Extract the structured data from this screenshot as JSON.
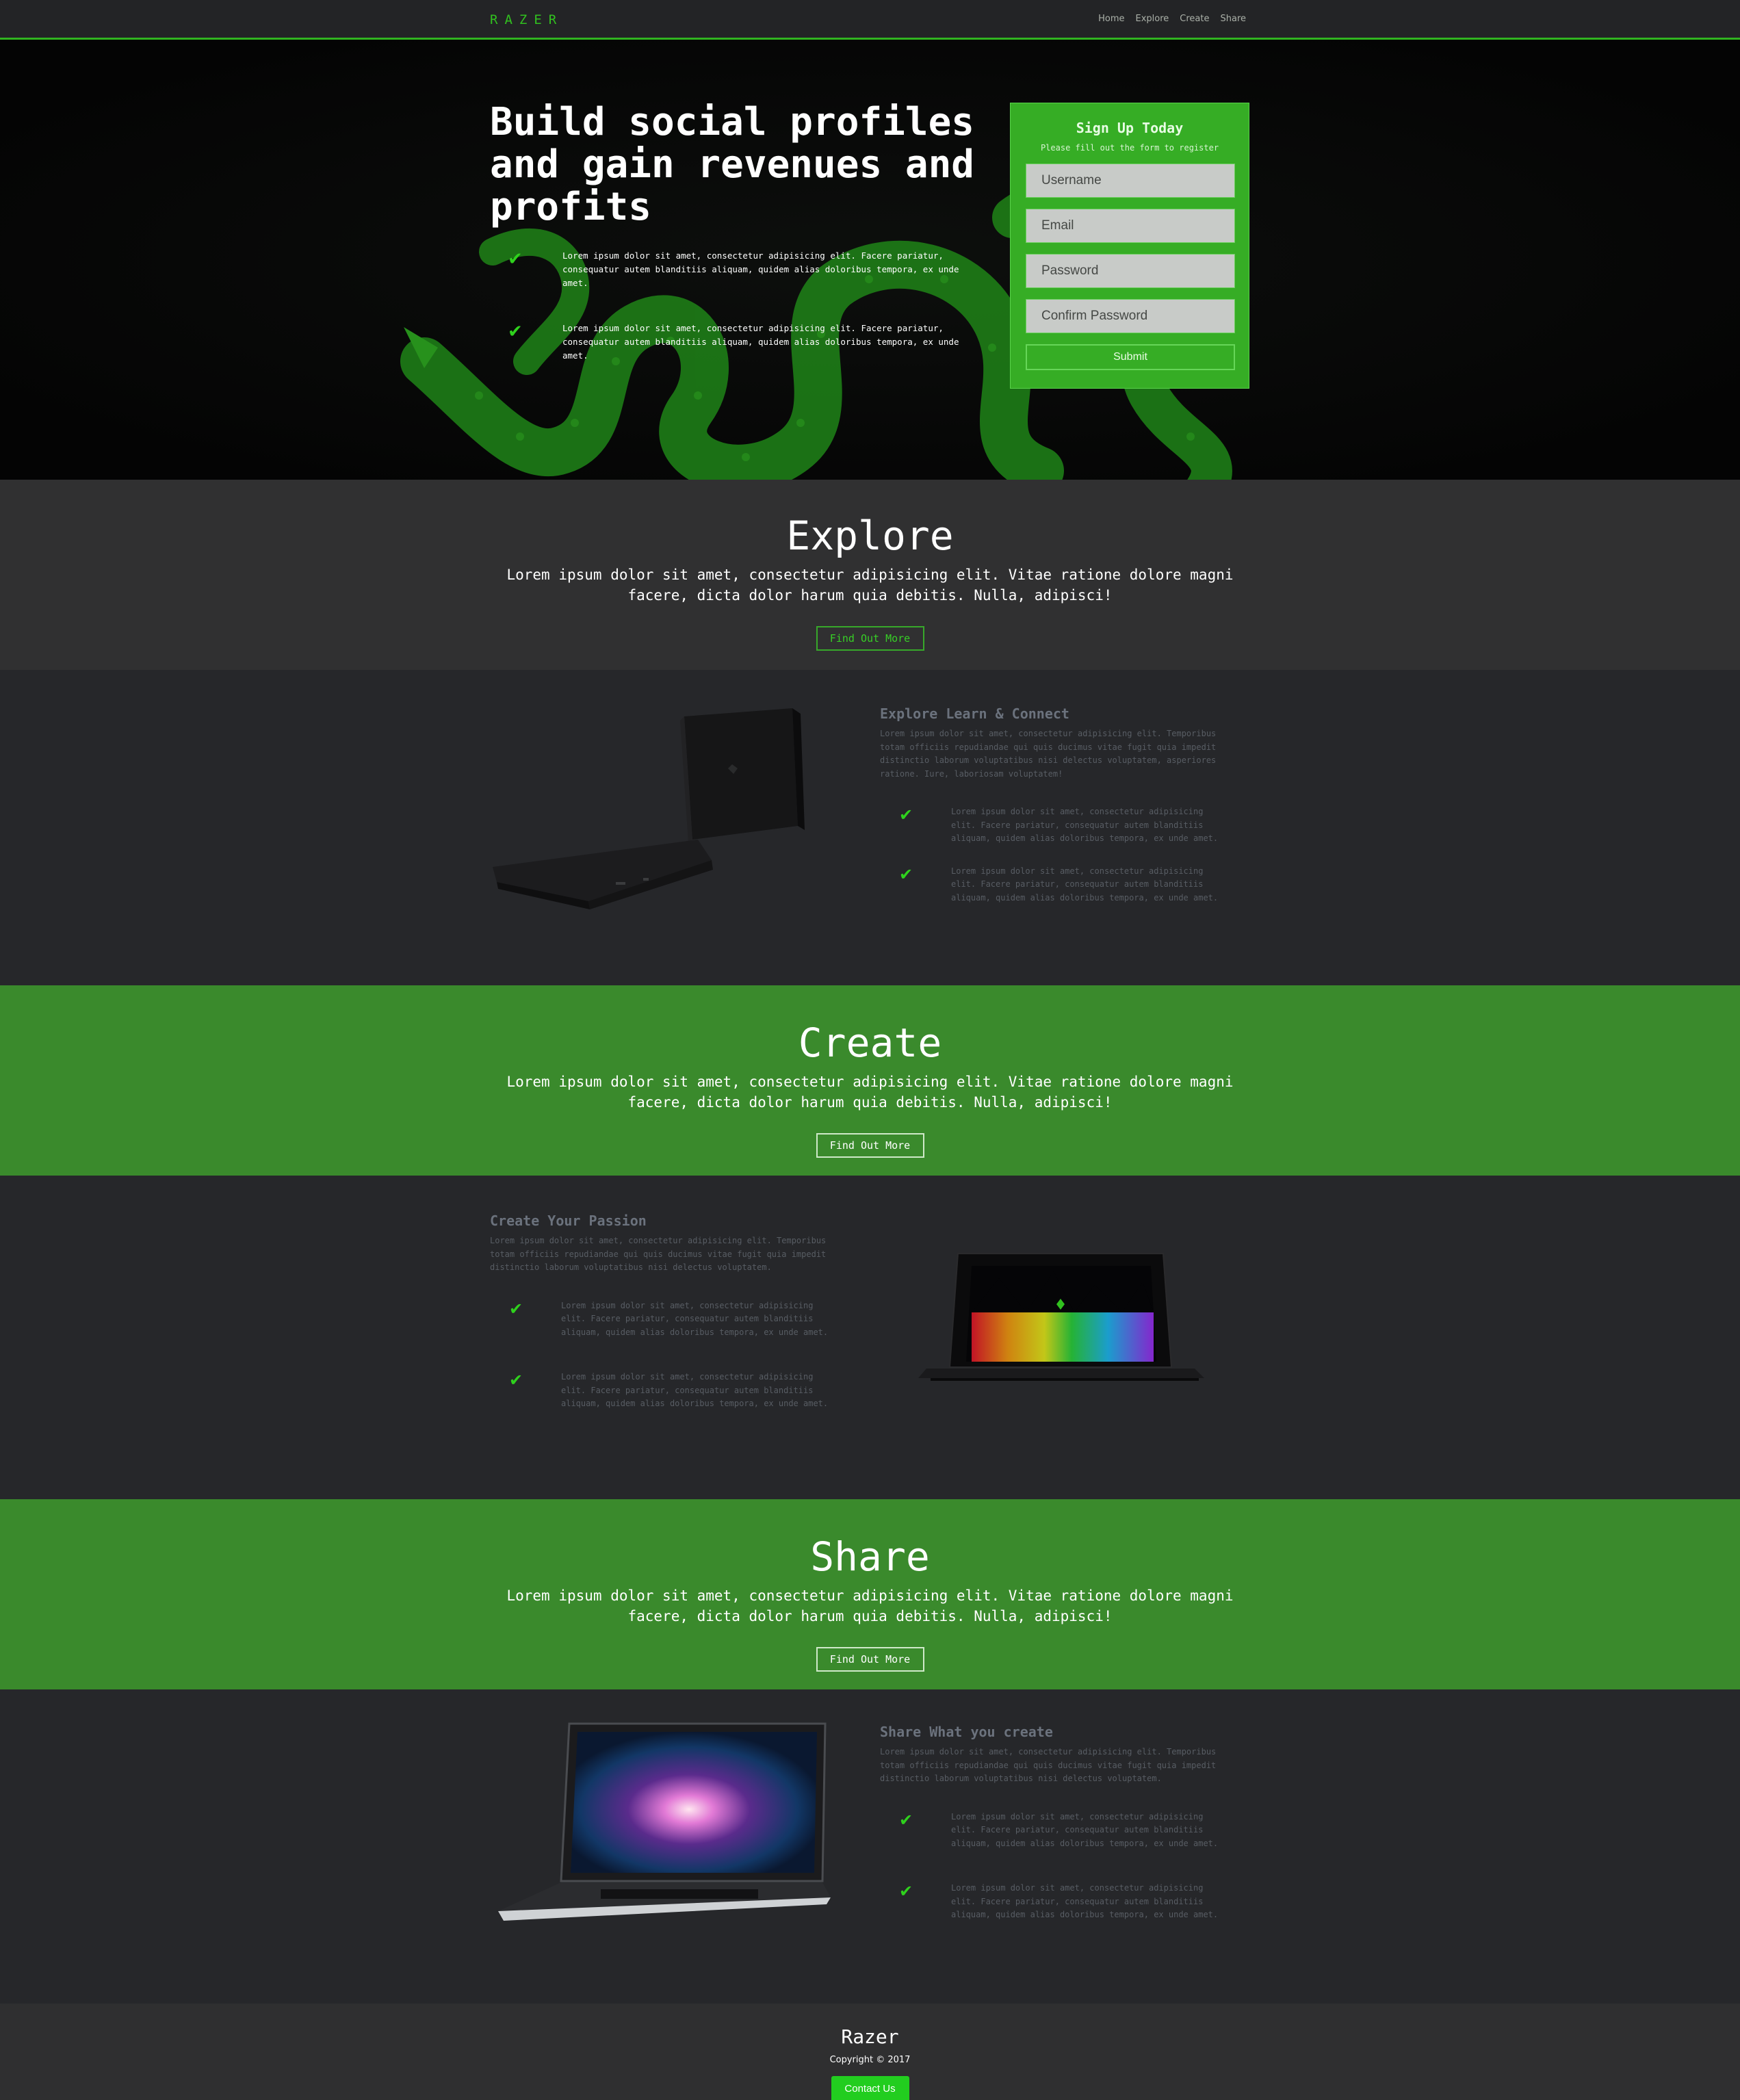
{
  "nav": {
    "brand": "RAZER",
    "links": [
      "Home",
      "Explore",
      "Create",
      "Share"
    ]
  },
  "hero": {
    "title": "Build social profiles and gain revenues and profits",
    "items": [
      "Lorem ipsum dolor sit amet, consectetur adipisicing elit. Facere pariatur, consequatur autem blanditiis aliquam, quidem alias doloribus tempora, ex unde amet.",
      "Lorem ipsum dolor sit amet, consectetur adipisicing elit. Facere pariatur, consequatur autem blanditiis aliquam, quidem alias doloribus tempora, ex unde amet."
    ]
  },
  "signup": {
    "title": "Sign Up Today",
    "subtitle": "Please fill out the form to register",
    "username_placeholder": "Username",
    "email_placeholder": "Email",
    "password_placeholder": "Password",
    "confirm_placeholder": "Confirm Password",
    "submit_label": "Submit"
  },
  "explore": {
    "title": "Explore",
    "text": "Lorem ipsum dolor sit amet, consectetur adipisicing elit. Vitae ratione dolore magni facere, dicta dolor harum quia debitis. Nulla, adipisci!",
    "button": "Find Out More"
  },
  "explore_feature": {
    "title": "Explore Learn & Connect",
    "intro": "Lorem ipsum dolor sit amet, consectetur adipisicing elit. Temporibus totam officiis repudiandae qui quis ducimus vitae fugit quia impedit distinctio laborum voluptatibus nisi delectus voluptatem, asperiores ratione. Iure, laboriosam voluptatem!",
    "items": [
      "Lorem ipsum dolor sit amet, consectetur adipisicing elit. Facere pariatur, consequatur autem blanditiis aliquam, quidem alias doloribus tempora, ex unde amet.",
      "Lorem ipsum dolor sit amet, consectetur adipisicing elit. Facere pariatur, consequatur autem blanditiis aliquam, quidem alias doloribus tempora, ex unde amet."
    ]
  },
  "create": {
    "title": "Create",
    "text": "Lorem ipsum dolor sit amet, consectetur adipisicing elit. Vitae ratione dolore magni facere, dicta dolor harum quia debitis. Nulla, adipisci!",
    "button": "Find Out More"
  },
  "create_feature": {
    "title": "Create Your Passion",
    "intro": "Lorem ipsum dolor sit amet, consectetur adipisicing elit. Temporibus totam officiis repudiandae qui quis ducimus vitae fugit quia impedit distinctio laborum voluptatibus nisi delectus voluptatem.",
    "items": [
      "Lorem ipsum dolor sit amet, consectetur adipisicing elit. Facere pariatur, consequatur autem blanditiis aliquam, quidem alias doloribus tempora, ex unde amet.",
      "Lorem ipsum dolor sit amet, consectetur adipisicing elit. Facere pariatur, consequatur autem blanditiis aliquam, quidem alias doloribus tempora, ex unde amet."
    ]
  },
  "share": {
    "title": "Share",
    "text": "Lorem ipsum dolor sit amet, consectetur adipisicing elit. Vitae ratione dolore magni facere, dicta dolor harum quia debitis. Nulla, adipisci!",
    "button": "Find Out More"
  },
  "share_feature": {
    "title": "Share What you create",
    "intro": "Lorem ipsum dolor sit amet, consectetur adipisicing elit. Temporibus totam officiis repudiandae qui quis ducimus vitae fugit quia impedit distinctio laborum voluptatibus nisi delectus voluptatem.",
    "items": [
      "Lorem ipsum dolor sit amet, consectetur adipisicing elit. Facere pariatur, consequatur autem blanditiis aliquam, quidem alias doloribus tempora, ex unde amet.",
      "Lorem ipsum dolor sit amet, consectetur adipisicing elit. Facere pariatur, consequatur autem blanditiis aliquam, quidem alias doloribus tempora, ex unde amet."
    ]
  },
  "footer": {
    "title": "Razer",
    "copyright": "Copyright © 2017",
    "contact": "Contact Us"
  },
  "icons": {
    "check": "check-icon",
    "serpent": "serpent-logo"
  },
  "colors": {
    "accent": "#31c11f",
    "band_green": "#3a8a2c",
    "signup_green": "#36ad25"
  }
}
